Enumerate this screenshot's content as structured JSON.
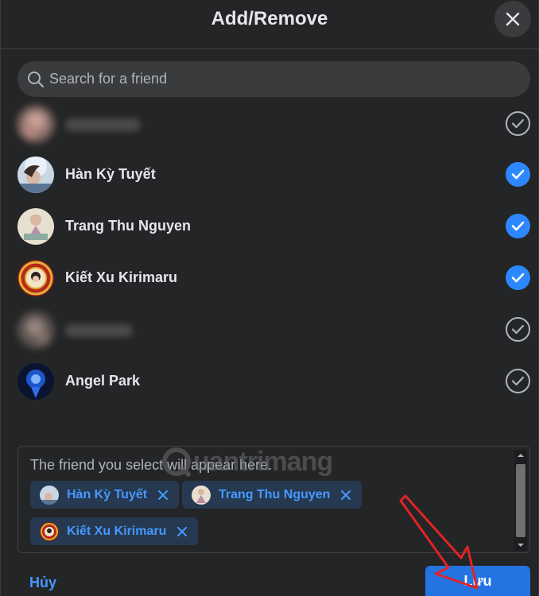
{
  "dialog": {
    "title": "Add/Remove",
    "close_icon": "close-icon"
  },
  "search": {
    "placeholder": "Search for a friend",
    "value": ""
  },
  "friends": [
    {
      "name": "",
      "blurred": true,
      "checked": false
    },
    {
      "name": "Hàn Kỳ Tuyết",
      "blurred": false,
      "checked": true
    },
    {
      "name": "Trang Thu Nguyen",
      "blurred": false,
      "checked": true
    },
    {
      "name": "Kiết Xu Kirimaru",
      "blurred": false,
      "checked": true
    },
    {
      "name": "",
      "blurred": true,
      "checked": false
    },
    {
      "name": "Angel Park",
      "blurred": false,
      "checked": false
    }
  ],
  "selected": {
    "hint": "The friend you select will appear here.",
    "chips": [
      {
        "label": "Hàn Kỳ Tuyết"
      },
      {
        "label": "Trang Thu Nguyen"
      },
      {
        "label": "Kiết Xu Kirimaru"
      }
    ]
  },
  "watermark": {
    "text": "uantrimang"
  },
  "footer": {
    "cancel_label": "Hủy",
    "save_label": "Lưu"
  },
  "colors": {
    "background": "#242526",
    "accent": "#2d88ff",
    "save_button": "#2374e1",
    "chip_background": "#263951",
    "chip_text": "#4599ff",
    "annotation_arrow": "#e02424"
  }
}
